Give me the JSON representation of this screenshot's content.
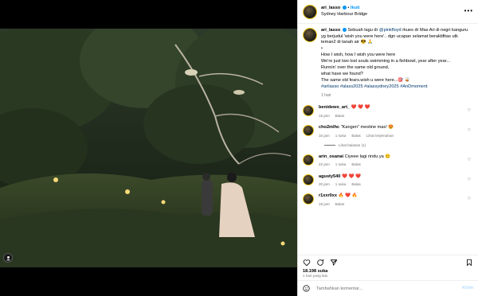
{
  "post": {
    "username": "ari_lasso",
    "follow_label": "Ikuti",
    "location": "Sydney Harbour Bridge",
    "caption": {
      "username": "ari_lasso",
      "line1_pre": "Sebuah lagu dr ",
      "mention": "@pinkfloyd",
      "line1_post": " rkues dr Mas Ari di negri kanguru yg berjudul 'wish you were here'.. dgn ucapan selamat beraktifitas utk teman2 di tanah air 😎 🙏",
      "bullet": "•",
      "lyric1": "How I wish, how I wish you were here",
      "lyric2": "We're just two lost souls swimming in a fishbowl, year after year...",
      "lyric3": "Runnin' over the same old ground,",
      "lyric4": "what have we found?",
      "lyric5": "The same old fears.wish u were here...🎯 🥃",
      "hashtags": "#arilasso #alass2025 #alassydney2025 #AnDmoment",
      "time": "1 hari"
    },
    "likes": "18.198 suka",
    "posted_ago": "1 hari yang lalu"
  },
  "comments": [
    {
      "user": "benidewo_art_",
      "text": "❤️ ❤️ ❤️",
      "time": "15 jam",
      "reply": "Balas",
      "likes": ""
    },
    {
      "user": "cho2mlhc",
      "text": "\"Kangen\" mestine mas! 😍",
      "time": "15 jam",
      "likes": "1 suka",
      "reply": "Balas",
      "translate": "Lihat terjemahan",
      "view_replies": "Lihat balasan (1)"
    },
    {
      "user": "arin_osanai",
      "text": "Ciyeee lagi rindu ya 😊",
      "time": "22 jam",
      "likes": "1 suka",
      "reply": "Balas"
    },
    {
      "user": "agusty540",
      "text": "❤️ ❤️ ❤️",
      "time": "20 jam",
      "likes": "1 suka",
      "reply": "Balas"
    },
    {
      "user": "r1xxr0xx",
      "text": "🔥 ❤️ 🔥",
      "time": "18 jam",
      "reply": "Balas",
      "likes": ""
    }
  ],
  "compose": {
    "placeholder": "Tambahkan komentar...",
    "send_label": "Kirim"
  },
  "icons": [
    "more-icon",
    "heart-icon",
    "comment-icon",
    "share-icon",
    "bookmark-icon",
    "emoji-icon",
    "user-tag-icon"
  ]
}
